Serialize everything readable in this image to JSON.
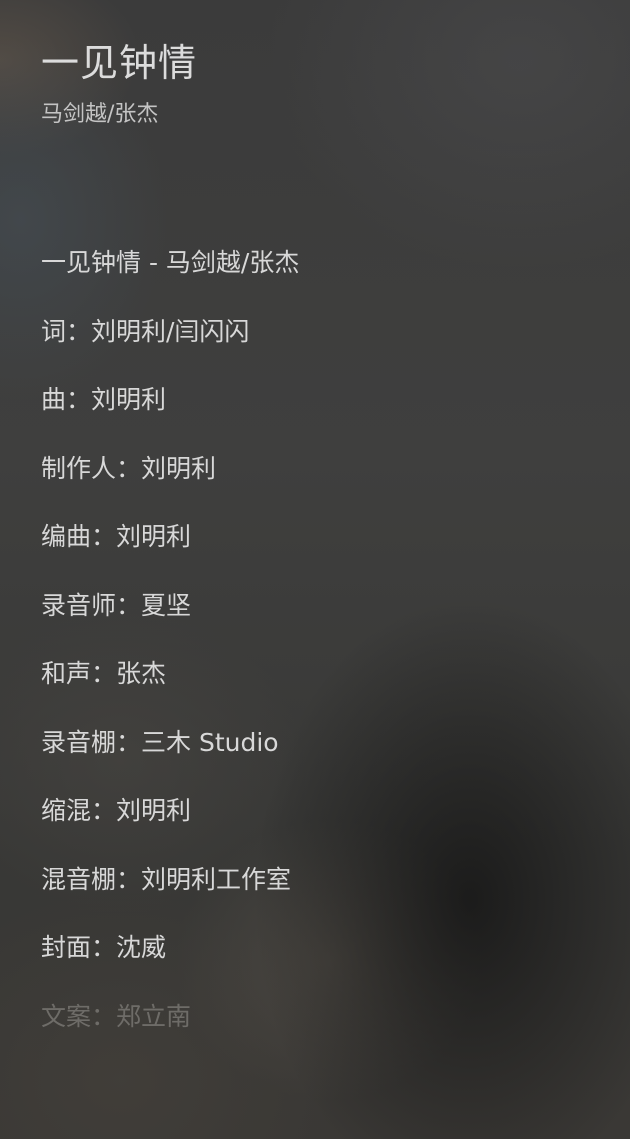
{
  "song": {
    "title": "一见钟情",
    "artist": "马剑越/张杰"
  },
  "lyrics": [
    "一见钟情 - 马剑越/张杰",
    "词：刘明利/闫闪闪",
    "曲：刘明利",
    "制作人：刘明利",
    "编曲：刘明利",
    "录音师：夏坚",
    "和声：张杰",
    "录音棚：三木 Studio",
    "缩混：刘明利",
    "混音棚：刘明利工作室",
    "封面：沈威",
    "文案：郑立南"
  ],
  "colors": {
    "text_primary": "#dcdcdc",
    "text_faded": "#6e6c68"
  }
}
